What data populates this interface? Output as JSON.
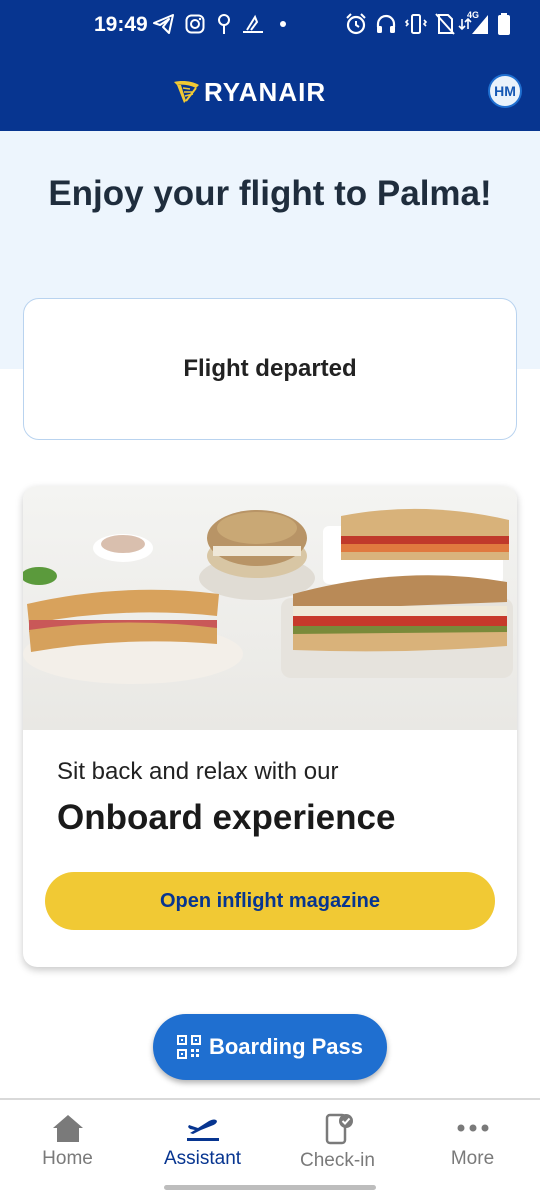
{
  "status_bar": {
    "time": "19:49",
    "network_label": "4G",
    "icons": [
      "telegram-icon",
      "instagram-icon",
      "location-icon",
      "app-icon",
      "dot-icon",
      "alarm-icon",
      "headphones-icon",
      "vibrate-icon",
      "no-sim-icon",
      "signal-icon",
      "battery-icon"
    ]
  },
  "header": {
    "brand": "RYANAIR",
    "avatar_initials": "HM"
  },
  "hero": {
    "title": "Enjoy your flight to Palma!"
  },
  "flight_status": {
    "text": "Flight departed"
  },
  "promo": {
    "subtitle": "Sit back and relax with our",
    "title": "Onboard experience",
    "button_label": "Open inflight magazine"
  },
  "boarding_pass": {
    "label": "Boarding Pass"
  },
  "bottom_nav": {
    "items": [
      {
        "label": "Home",
        "icon": "home-icon"
      },
      {
        "label": "Assistant",
        "icon": "plane-icon"
      },
      {
        "label": "Check-in",
        "icon": "phone-check-icon"
      },
      {
        "label": "More",
        "icon": "more-icon"
      }
    ],
    "active_index": 1
  },
  "colors": {
    "brand_blue": "#073590",
    "accent_blue": "#1f6fd0",
    "yellow": "#f1c934",
    "hero_bg": "#edf5fd"
  }
}
